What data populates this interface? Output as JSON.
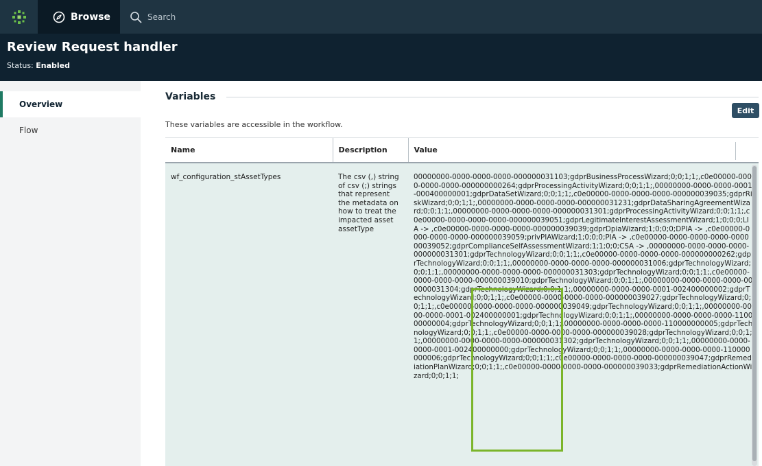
{
  "topbar": {
    "logo_icon": "sailpoint-logo-icon",
    "browse_label": "Browse",
    "search_placeholder": "Search"
  },
  "header": {
    "title": "Review Request handler",
    "status_label": "Status:",
    "status_value": "Enabled"
  },
  "sidebar": {
    "items": [
      {
        "label": "Overview",
        "active": true
      },
      {
        "label": "Flow",
        "active": false
      }
    ]
  },
  "section": {
    "title": "Variables",
    "edit_label": "Edit",
    "description": "These variables are accessible in the workflow."
  },
  "table": {
    "headers": [
      "Name",
      "Description",
      "Value"
    ],
    "rows": [
      {
        "name": "wf_configuration_stAssetTypes",
        "description": "The csv (,) string of csv (;) strings that represent the metadata on how to treat the impacted asset assetType",
        "value": "00000000-0000-0000-0000-000000031103;gdprBusinessProcessWizard;0;0;1;1;,c0e00000-0000-0000-0000-000000000264;gdprProcessingActivityWizard;0;0;1;1;,00000000-0000-0000-0001-000400000001;gdprDataSetWizard;0;0;1;1;,c0e00000-0000-0000-0000-000000039035;gdprRiskWizard;0;0;1;1;,00000000-0000-0000-0000-000000031231;gdprDataSharingAgreementWizard;0;0;1;1;,00000000-0000-0000-0000-000000031301;gdprProcessingActivityWizard;0;0;1;1;,c0e00000-0000-0000-0000-000000039051;gdprLegitimateInterestAssessmentWizard;1;0;0;0;LIA -> ,c0e00000-0000-0000-0000-000000039039;gdprDpiaWizard;1;0;0;0;DPIA -> ,c0e00000-0000-0000-0000-000000039059;privPIAWizard;1;0;0;0;PIA -> ,c0e00000-0000-0000-0000-000000039052;gdprComplianceSelfAssessmentWizard;1;1;0;0;CSA -> ,00000000-0000-0000-0000-000000031301;gdprTechnologyWizard;0;0;1;1;,c0e00000-0000-0000-0000-000000000262;gdprTechnologyWizard;0;0;1;1;,00000000-0000-0000-0000-000000031006;gdprTechnologyWizard;0;0;1;1;,00000000-0000-0000-0000-000000031303;gdprTechnologyWizard;0;0;1;1;,c0e00000-0000-0000-0000-000000039010;gdprTechnologyWizard;0;0;1;1;,00000000-0000-0000-0000-000000031304;gdprTechnologyWizard;0;0;1;1;,00000000-0000-0000-0001-002400000002;gdprTechnologyWizard;0;0;1;1;,c0e00000-0000-0000-0000-000000039027;gdprTechnologyWizard;0;0;1;1;,c0e00000-0000-0000-0000-000000039049;gdprTechnologyWizard;0;0;1;1;,00000000-0000-0000-0001-002400000001;gdprTechnologyWizard;0;0;1;1;,00000000-0000-0000-0000-110000000004;gdprTechnologyWizard;0;0;1;1;,00000000-0000-0000-0000-110000000005;gdprTechnologyWizard;0;0;1;1;,c0e00000-0000-0000-0000-000000039028;gdprTechnologyWizard;0;0;1;1;,00000000-0000-0000-0000-000000031302;gdprTechnologyWizard;0;0;1;1;,00000000-0000-0000-0001-002400000000;gdprTechnologyWizard;0;0;1;1;,00000000-0000-0000-0000-110000000006;gdprTechnologyWizard;0;0;1;1;,c0e00000-0000-0000-0000-000000039047;gdprRemediationPlanWizard;0;0;1;1;,c0e00000-0000-0000-0000-000000039033;gdprRemediationActionWizard;0;0;1;1;"
      }
    ]
  },
  "colors": {
    "topbar_bg": "#0f2230",
    "accent": "#1f7a63",
    "edit_button": "#2e4e64",
    "row_bg": "#e4efed",
    "highlight": "#7bb52a"
  }
}
